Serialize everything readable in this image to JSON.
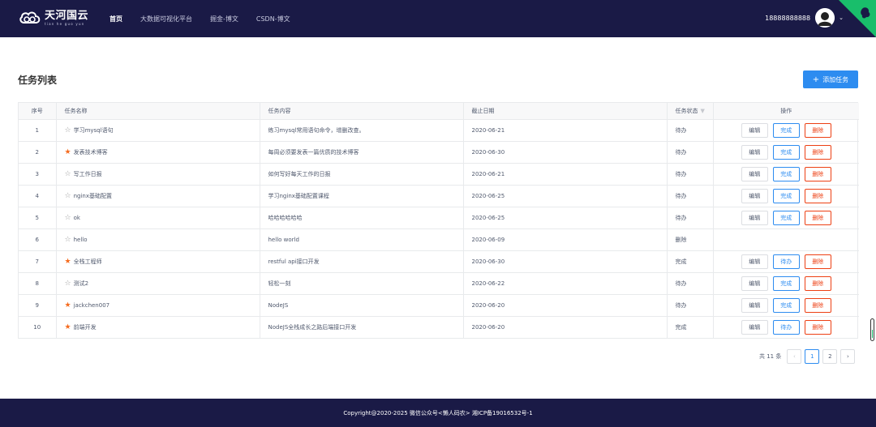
{
  "header": {
    "logo_text": "天河国云",
    "logo_subtext": "tian he guo yun",
    "nav": [
      {
        "label": "首页",
        "active": true
      },
      {
        "label": "大数据可视化平台",
        "active": false
      },
      {
        "label": "掘金-博文",
        "active": false
      },
      {
        "label": "CSDN-博文",
        "active": false
      }
    ],
    "user_phone": "18888888888",
    "colors": {
      "bar": "#1a1a46",
      "corner_ribbon": "#19be6b"
    }
  },
  "page": {
    "title": "任务列表",
    "add_button_label": "添加任务",
    "add_button_icon": "plus-icon"
  },
  "table": {
    "columns": [
      "序号",
      "任务名称",
      "任务内容",
      "截止日期",
      "任务状态",
      "操作"
    ],
    "status_filter_icon": "filter-icon",
    "rows": [
      {
        "no": "1",
        "starred": false,
        "name": "学习mysql语句",
        "content": "练习mysql常用语句命令，增删改查。",
        "deadline": "2020-06-21",
        "status": "待办",
        "actions": [
          "编辑",
          "完成",
          "删除"
        ]
      },
      {
        "no": "2",
        "starred": true,
        "name": "发表技术博客",
        "content": "每周必须要发表一篇优质的技术博客",
        "deadline": "2020-06-30",
        "status": "待办",
        "actions": [
          "编辑",
          "完成",
          "删除"
        ]
      },
      {
        "no": "3",
        "starred": false,
        "name": "写工作日报",
        "content": "如何写好每天工作的日报",
        "deadline": "2020-06-21",
        "status": "待办",
        "actions": [
          "编辑",
          "完成",
          "删除"
        ]
      },
      {
        "no": "4",
        "starred": false,
        "name": "nginx基础配置",
        "content": "学习nginx基础配置课程",
        "deadline": "2020-06-25",
        "status": "待办",
        "actions": [
          "编辑",
          "完成",
          "删除"
        ]
      },
      {
        "no": "5",
        "starred": false,
        "name": "ok",
        "content": "哈哈哈哈哈哈",
        "deadline": "2020-06-25",
        "status": "待办",
        "actions": [
          "编辑",
          "完成",
          "删除"
        ]
      },
      {
        "no": "6",
        "starred": false,
        "name": "hello",
        "content": "hello world",
        "deadline": "2020-06-09",
        "status": "删除",
        "actions": []
      },
      {
        "no": "7",
        "starred": true,
        "name": "全栈工程师",
        "content": "restful api接口开发",
        "deadline": "2020-06-30",
        "status": "完成",
        "actions": [
          "编辑",
          "待办",
          "删除"
        ]
      },
      {
        "no": "8",
        "starred": false,
        "name": "测试2",
        "content": "轻松一刻",
        "deadline": "2020-06-22",
        "status": "待办",
        "actions": [
          "编辑",
          "完成",
          "删除"
        ]
      },
      {
        "no": "9",
        "starred": true,
        "name": "jackchen007",
        "content": "NodeJS",
        "deadline": "2020-06-20",
        "status": "待办",
        "actions": [
          "编辑",
          "完成",
          "删除"
        ]
      },
      {
        "no": "10",
        "starred": true,
        "name": "前端开发",
        "content": "NodeJS全栈成长之路后端接口开发",
        "deadline": "2020-06-20",
        "status": "完成",
        "actions": [
          "编辑",
          "待办",
          "删除"
        ]
      }
    ]
  },
  "pagination": {
    "total_label": "共 11 条",
    "pages": [
      "1",
      "2"
    ],
    "current": "1"
  },
  "footer": {
    "text": "Copyright@2020-2025 微信公众号<懒人码农> 湘ICP备19016532号-1"
  }
}
